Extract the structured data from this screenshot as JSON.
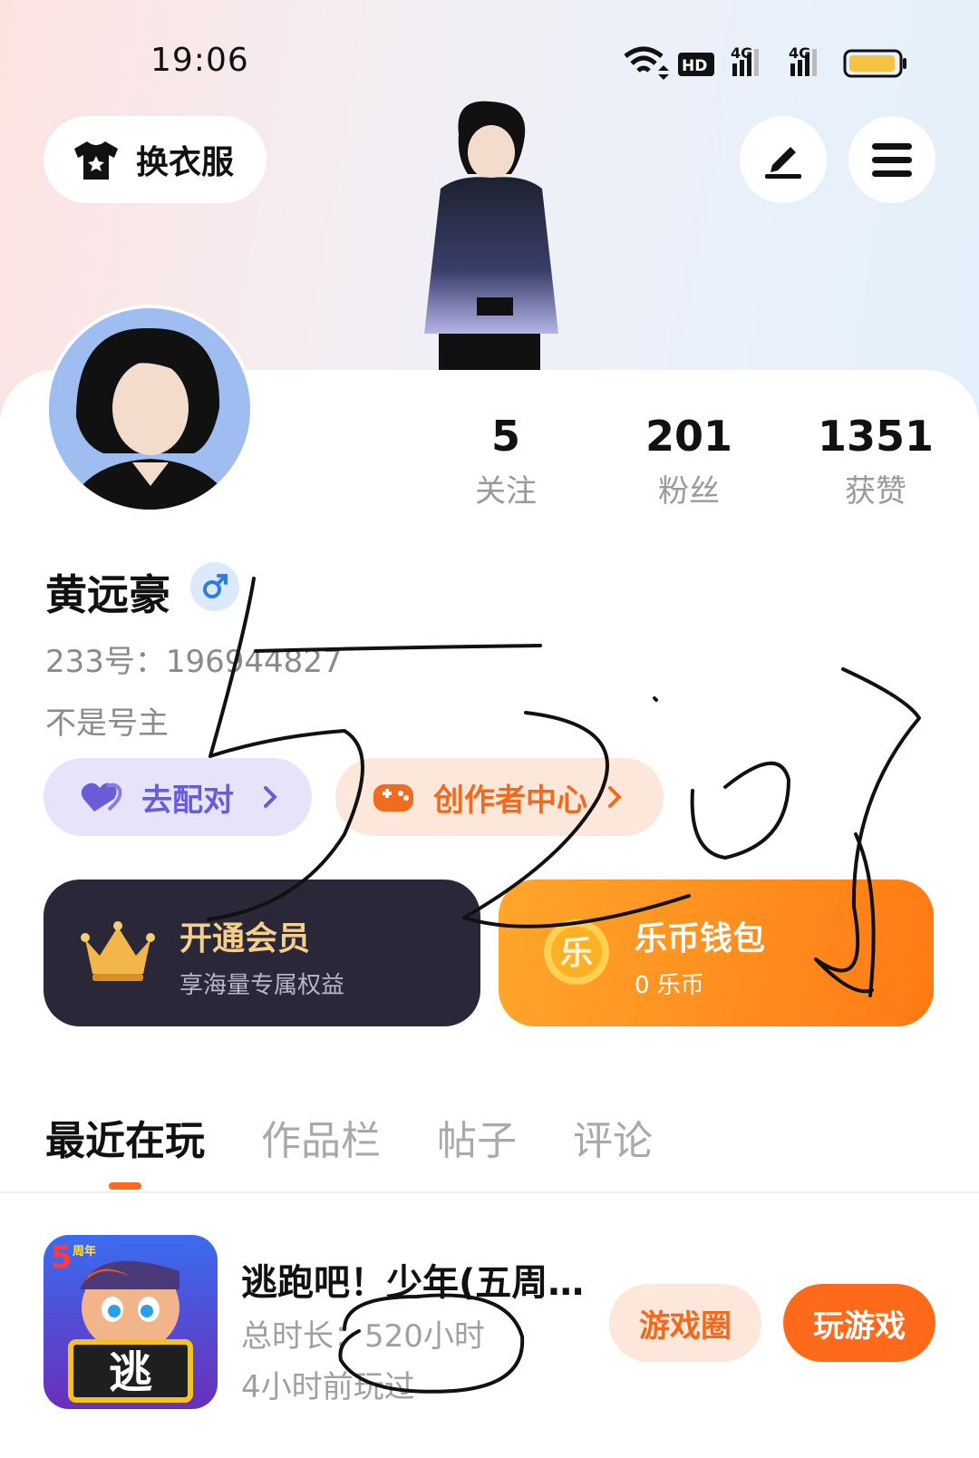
{
  "status_bar": {
    "time": "19:06",
    "icons": [
      "wifi-icon",
      "hd-icon",
      "signal-4g-icon",
      "signal-4g-icon",
      "battery-icon"
    ],
    "hd_label": "HD",
    "net_label_1": "4G",
    "net_label_2": "4G"
  },
  "header": {
    "outfit_label": "换衣服",
    "outfit_icon": "tshirt-icon",
    "edit_icon": "pen-icon",
    "menu_icon": "menu-icon"
  },
  "stats": [
    {
      "value": "5",
      "label": "关注"
    },
    {
      "value": "201",
      "label": "粉丝"
    },
    {
      "value": "1351",
      "label": "获赞"
    }
  ],
  "profile": {
    "name": "黄远豪",
    "gender_icon": "male-icon",
    "uid": "233号：196944827",
    "bio": "不是号主"
  },
  "chips": {
    "match_label": "去配对",
    "creator_label": "创作者中心"
  },
  "promos": {
    "vip_title": "开通会员",
    "vip_sub": "享海量专属权益",
    "wallet_title": "乐币钱包",
    "wallet_sub": "0 乐币",
    "coin_char": "乐"
  },
  "tabs": [
    "最近在玩",
    "作品栏",
    "帖子",
    "评论"
  ],
  "game": {
    "title": "逃跑吧！少年(五周…",
    "duration": "总时长：520小时",
    "last_played": "4小时前玩过",
    "icon_char": "逃",
    "icon_badge": "5",
    "icon_badge_text": "周年",
    "circle_label": "游戏圈",
    "play_label": "玩游戏"
  },
  "colors": {
    "accent": "#ff6a1a",
    "match": "#6a5bd6",
    "creator": "#f06a1f",
    "vip_bg": "#2a2838",
    "wallet_bg": "#ff8a1c"
  }
}
